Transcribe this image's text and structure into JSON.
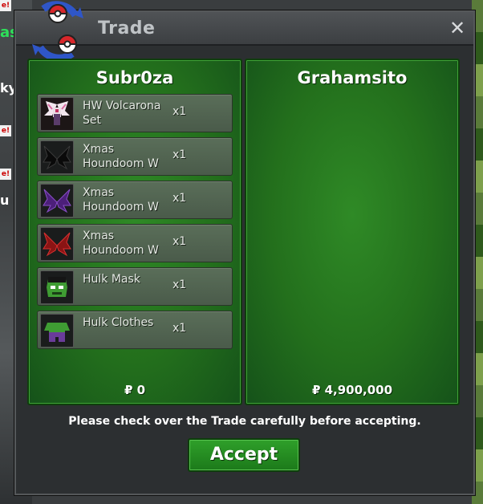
{
  "window": {
    "title": "Trade",
    "close_label": "✕"
  },
  "background": {
    "tag_1": "e!",
    "tag_2": "e!",
    "tag_3": "e!",
    "name_1": "as",
    "name_2": "ky",
    "name_3": "u"
  },
  "left_panel": {
    "player_name": "Subr0za",
    "money": "₽ 0",
    "items": [
      {
        "name": "HW Volcarona Set",
        "qty": "x1",
        "icon": "volcarona-set-icon"
      },
      {
        "name": "Xmas Houndoom W",
        "qty": "x1",
        "icon": "black-wings-icon"
      },
      {
        "name": "Xmas Houndoom W",
        "qty": "x1",
        "icon": "purple-wings-icon"
      },
      {
        "name": "Xmas Houndoom W",
        "qty": "x1",
        "icon": "red-wings-icon"
      },
      {
        "name": "Hulk Mask",
        "qty": "x1",
        "icon": "hulk-mask-icon"
      },
      {
        "name": "Hulk Clothes",
        "qty": "x1",
        "icon": "hulk-clothes-icon"
      }
    ]
  },
  "right_panel": {
    "player_name": "Grahamsito",
    "money": "₽ 4,900,000",
    "items": []
  },
  "footer": {
    "notice": "Please check over the Trade carefully before accepting.",
    "accept_label": "Accept"
  },
  "colors": {
    "panel_green": "#236f1c",
    "accept_green": "#1c7a1a",
    "window_bg": "#2c2f31"
  }
}
